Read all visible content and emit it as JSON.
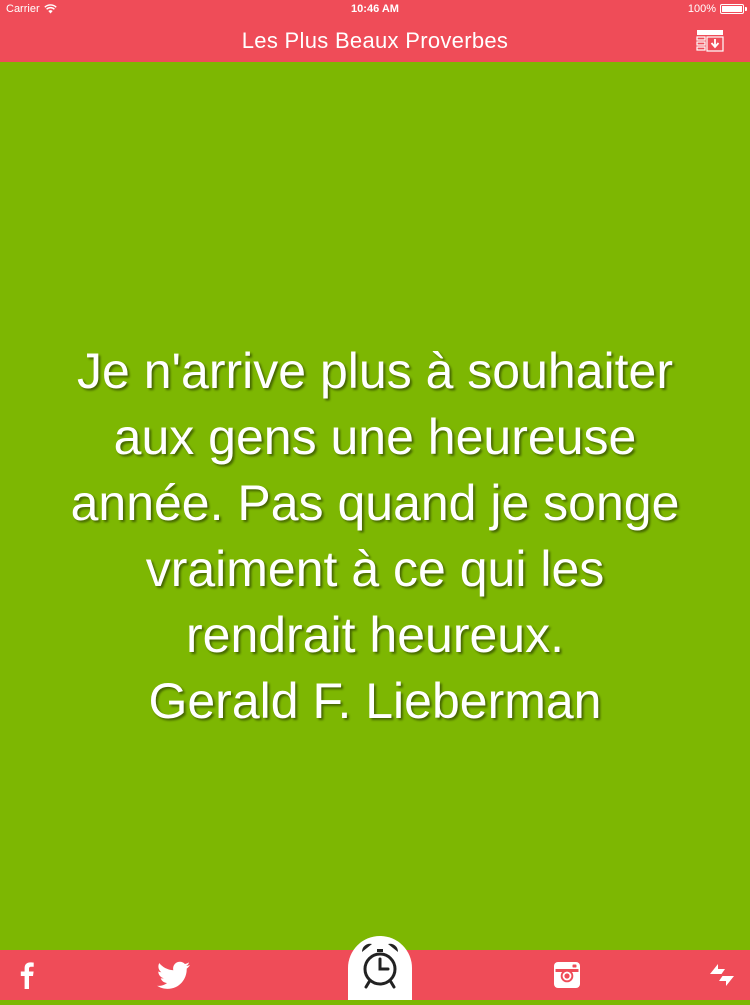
{
  "status_bar": {
    "carrier": "Carrier",
    "time": "10:46 AM",
    "battery": "100%"
  },
  "nav": {
    "title": "Les Plus Beaux Proverbes",
    "menu_icon": "download-list-icon"
  },
  "quote": {
    "lines": [
      "Je n'arrive plus à souhaiter",
      "aux gens une heureuse",
      "année. Pas quand je songe",
      "vraiment à ce qui les",
      "rendrait heureux.",
      "Gerald F. Lieberman"
    ],
    "background_color": "#7db702"
  },
  "tab_bar": {
    "items": [
      {
        "icon": "facebook-icon"
      },
      {
        "icon": "twitter-icon"
      },
      {
        "icon": "alarm-clock-icon"
      },
      {
        "icon": "instagram-icon"
      },
      {
        "icon": "shuffle-icon"
      }
    ]
  },
  "colors": {
    "accent": "#ef4c58",
    "quote_background": "#7db702",
    "text": "#ffffff"
  }
}
